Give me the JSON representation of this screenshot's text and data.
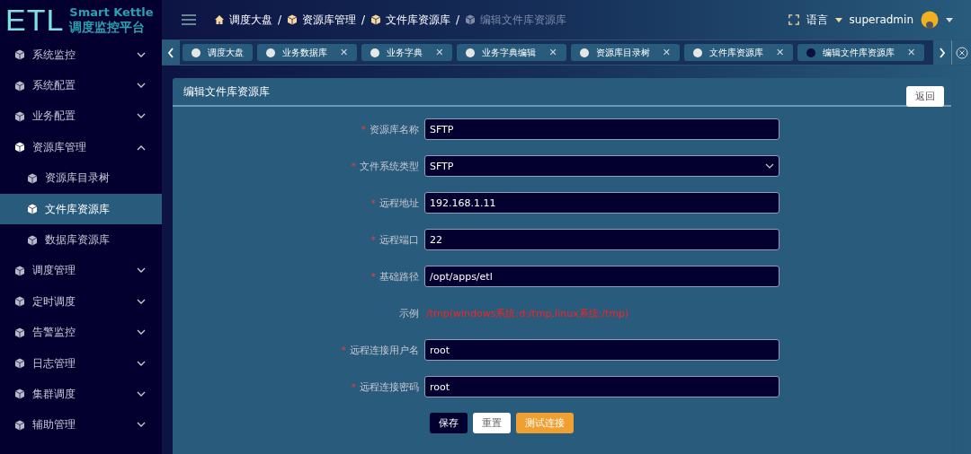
{
  "brand": {
    "logo": "ETL",
    "name": "Smart Kettle",
    "subtitle": "调度监控平台"
  },
  "breadcrumb": [
    {
      "label": "调度大盘",
      "current": false
    },
    {
      "separator": "/",
      "label": "资源库管理",
      "current": false
    },
    {
      "separator": "/",
      "label": "文件库资源库",
      "current": false
    },
    {
      "separator": "/",
      "label": "编辑文件库资源库",
      "current": true
    }
  ],
  "header": {
    "language": "语言",
    "user": "superadmin"
  },
  "sidebar": {
    "items": [
      {
        "label": "系统监控",
        "expanded": false,
        "selected": false
      },
      {
        "label": "系统配置",
        "expanded": false,
        "selected": false
      },
      {
        "label": "业务配置",
        "expanded": false,
        "selected": false
      },
      {
        "label": "资源库管理",
        "expanded": true,
        "selected": false,
        "children": [
          {
            "label": "资源库目录树",
            "selected": false
          },
          {
            "label": "文件库资源库",
            "selected": true
          },
          {
            "label": "数据库资源库",
            "selected": false
          }
        ]
      },
      {
        "label": "调度管理",
        "expanded": false,
        "selected": false
      },
      {
        "label": "定时调度",
        "expanded": false,
        "selected": false
      },
      {
        "label": "告警监控",
        "expanded": false,
        "selected": false
      },
      {
        "label": "日志管理",
        "expanded": false,
        "selected": false
      },
      {
        "label": "集群调度",
        "expanded": false,
        "selected": false
      },
      {
        "label": "辅助管理",
        "expanded": false,
        "selected": false
      }
    ]
  },
  "tabs": [
    {
      "label": "调度大盘",
      "selected": false
    },
    {
      "label": "业务数据库",
      "selected": false,
      "close": "✕"
    },
    {
      "label": "业务字典",
      "selected": false,
      "close": "✕"
    },
    {
      "label": "业务字典编辑",
      "selected": false,
      "close": "✕"
    },
    {
      "label": "资源库目录树",
      "selected": false,
      "close": "✕"
    },
    {
      "label": "文件库资源库",
      "selected": false,
      "close": "✕"
    },
    {
      "label": "编辑文件库资源库",
      "selected": true,
      "close": "✕"
    }
  ],
  "panel": {
    "title": "编辑文件库资源库",
    "back_button": "返回",
    "fields": [
      {
        "kind": "input",
        "required_mark": "*",
        "label": "资源库名称",
        "value": "SFTP"
      },
      {
        "kind": "select",
        "required_mark": "*",
        "label": "文件系统类型",
        "value": "SFTP"
      },
      {
        "kind": "input",
        "required_mark": "*",
        "label": "远程地址",
        "value": "192.168.1.11"
      },
      {
        "kind": "input",
        "required_mark": "*",
        "label": "远程端口",
        "value": "22"
      },
      {
        "kind": "input",
        "required_mark": "*",
        "label": "基础路径",
        "value": "/opt/apps/etl"
      },
      {
        "kind": "example",
        "label": "示例",
        "value": "/tmp(windows系统:d:/tmp,linux系统:/tmp)"
      },
      {
        "kind": "input",
        "required_mark": "*",
        "label": "远程连接用户名",
        "value": "root"
      },
      {
        "kind": "input",
        "required_mark": "*",
        "label": "远程连接密码",
        "value": "root"
      }
    ],
    "buttons": [
      {
        "label": "保存",
        "kind": "primary"
      },
      {
        "label": "重置",
        "kind": "plain"
      },
      {
        "label": "测试连接",
        "kind": "warning"
      }
    ]
  }
}
